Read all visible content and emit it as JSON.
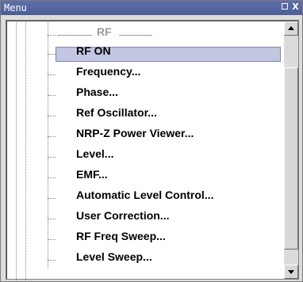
{
  "window": {
    "title": "Menu",
    "restore_icon": "restore-icon",
    "close_icon": "close-icon",
    "close_glyph": "X"
  },
  "menu": {
    "section_header": "RF",
    "items": [
      {
        "label": "RF ON",
        "selected": true
      },
      {
        "label": "Frequency..."
      },
      {
        "label": "Phase..."
      },
      {
        "label": "Ref Oscillator..."
      },
      {
        "label": "NRP-Z Power Viewer..."
      },
      {
        "label": "Level..."
      },
      {
        "label": "EMF..."
      },
      {
        "label": "Automatic Level Control..."
      },
      {
        "label": "User Correction..."
      },
      {
        "label": "RF Freq Sweep..."
      },
      {
        "label": "Level Sweep..."
      }
    ]
  },
  "colors": {
    "titlebar": "#4b5c98",
    "selection": "#c3c6e0",
    "header_text": "#9a9a9a"
  }
}
